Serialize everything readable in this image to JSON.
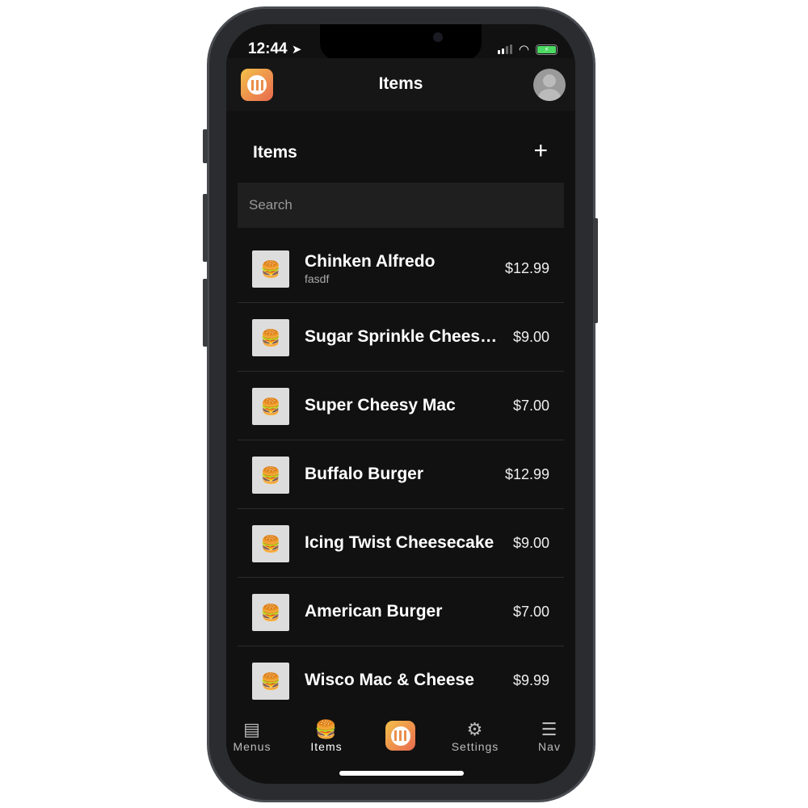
{
  "status": {
    "time": "12:44"
  },
  "header": {
    "title": "Items"
  },
  "section": {
    "title": "Items",
    "add_label": "+"
  },
  "search": {
    "placeholder": "Search",
    "value": ""
  },
  "items": [
    {
      "name": "Chinken Alfredo",
      "description": "fasdf",
      "price": "$12.99"
    },
    {
      "name": "Sugar Sprinkle Cheesecake",
      "price": "$9.00"
    },
    {
      "name": "Super Cheesy Mac",
      "price": "$7.00"
    },
    {
      "name": "Buffalo Burger",
      "price": "$12.99"
    },
    {
      "name": "Icing Twist Cheesecake",
      "price": "$9.00"
    },
    {
      "name": "American Burger",
      "price": "$7.00"
    },
    {
      "name": "Wisco Mac & Cheese",
      "price": "$9.99"
    }
  ],
  "tabs": [
    {
      "label": "Menus",
      "icon": "menu-book-icon"
    },
    {
      "label": "Items",
      "icon": "burger-drink-icon",
      "active": true
    },
    {
      "label": "",
      "icon": "app-logo-icon"
    },
    {
      "label": "Settings",
      "icon": "gear-icon"
    },
    {
      "label": "Nav",
      "icon": "hamburger-icon"
    }
  ],
  "colors": {
    "brand_start": "#f3c04a",
    "brand_end": "#e96a4f",
    "battery": "#4cd964"
  }
}
